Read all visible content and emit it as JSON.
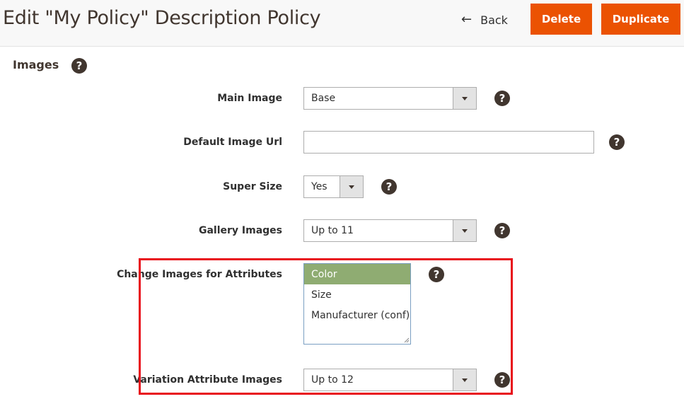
{
  "header": {
    "title": "Edit \"My Policy\" Description Policy",
    "back_label": "Back",
    "back_arrow": "←",
    "delete_label": "Delete",
    "duplicate_label": "Duplicate"
  },
  "section": {
    "title": "Images",
    "help": "?"
  },
  "fields": {
    "main_image": {
      "label": "Main Image",
      "value": "Base",
      "help": "?"
    },
    "default_image_url": {
      "label": "Default Image Url",
      "value": "",
      "help": "?"
    },
    "super_size": {
      "label": "Super Size",
      "value": "Yes",
      "help": "?"
    },
    "gallery_images": {
      "label": "Gallery Images",
      "value": "Up to 11",
      "help": "?"
    },
    "change_images": {
      "label": "Change Images for Attributes",
      "options": [
        "Color",
        "Size",
        "Manufacturer (conf)"
      ],
      "selected": "Color",
      "help": "?"
    },
    "variation_images": {
      "label": "Variation Attribute Images",
      "value": "Up to 12",
      "help": "?"
    }
  },
  "colors": {
    "accent": "#eb5202",
    "selected_option": "#8fac72",
    "highlight": "#e8101b",
    "help_icon": "#41362f"
  },
  "icons": {
    "back": "arrow-left-icon",
    "help": "question-circle-icon",
    "dropdown": "chevron-down-icon"
  }
}
